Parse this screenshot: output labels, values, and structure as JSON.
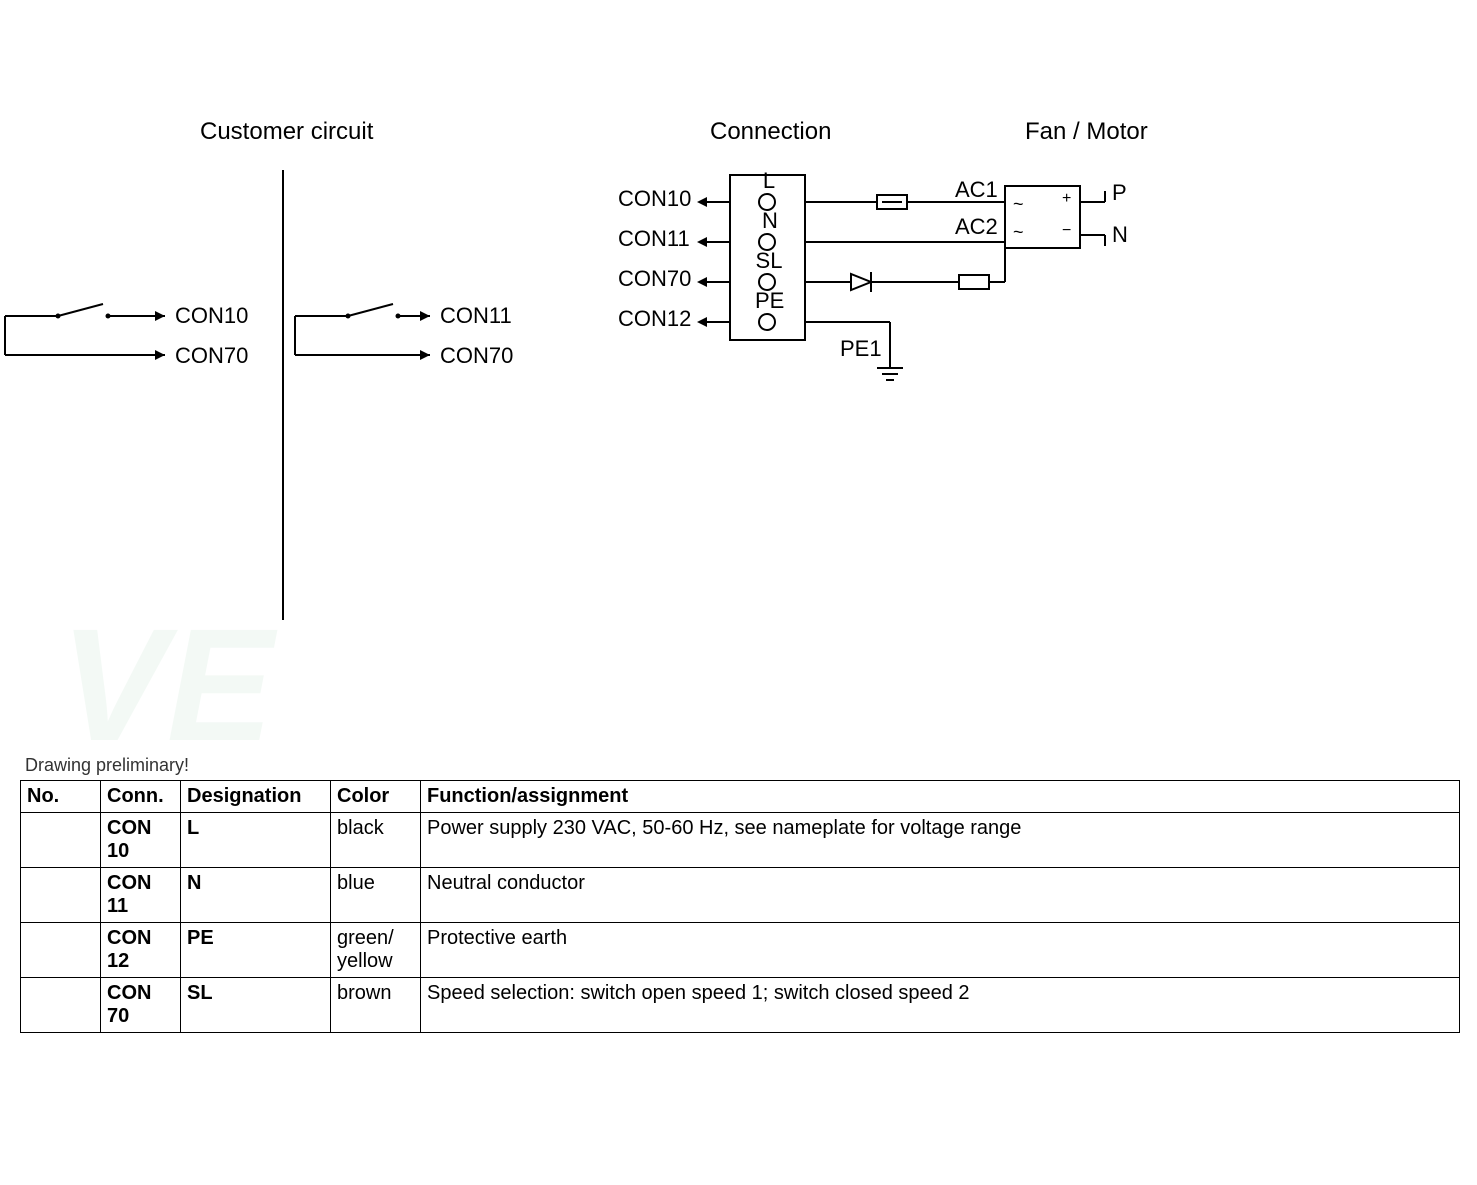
{
  "sections": {
    "customer_circuit": "Customer circuit",
    "connection": "Connection",
    "fan_motor": "Fan / Motor"
  },
  "customer": {
    "con10": "CON10",
    "con11": "CON11",
    "con70_left": "CON70",
    "con70_right": "CON70"
  },
  "connection": {
    "con10": "CON10",
    "con11": "CON11",
    "con70": "CON70",
    "con12": "CON12",
    "L": "L",
    "N": "N",
    "SL": "SL",
    "PE": "PE",
    "PE1": "PE1"
  },
  "motor": {
    "AC1": "AC1",
    "AC2": "AC2",
    "P": "P",
    "N": "N",
    "tilde1": "~",
    "tilde2": "~",
    "plus": "+",
    "minus": "−"
  },
  "note": "Drawing preliminary!",
  "table": {
    "headers": {
      "no": "No.",
      "conn": "Conn.",
      "designation": "Designation",
      "color": "Color",
      "function": "Function/assignment"
    },
    "rows": [
      {
        "no": "",
        "conn": "CON 10",
        "designation": "L",
        "color": "black",
        "function": "Power supply 230 VAC, 50-60 Hz, see nameplate for voltage range"
      },
      {
        "no": "",
        "conn": "CON 11",
        "designation": "N",
        "color": "blue",
        "function": "Neutral conductor"
      },
      {
        "no": "",
        "conn": "CON 12",
        "designation": "PE",
        "color": "green/ yellow",
        "function": "Protective earth"
      },
      {
        "no": "",
        "conn": "CON 70",
        "designation": "SL",
        "color": "brown",
        "function": "Speed selection: switch open speed 1; switch closed speed 2"
      }
    ]
  }
}
